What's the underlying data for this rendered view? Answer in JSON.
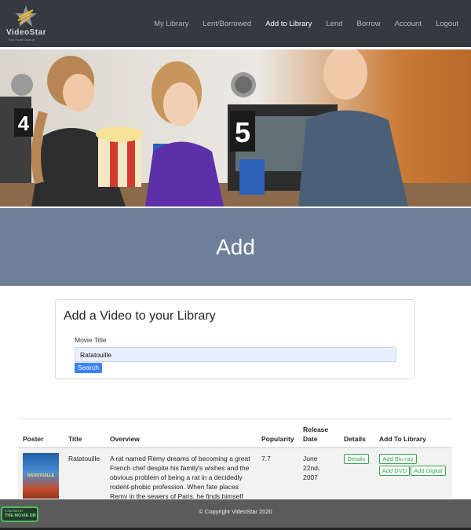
{
  "brand": {
    "name": "VideoStar",
    "tagline": "Your movie catalog"
  },
  "nav": {
    "items": [
      {
        "label": "My Library",
        "active": false
      },
      {
        "label": "Lent/Borrowed",
        "active": false
      },
      {
        "label": "Add to Library",
        "active": true
      },
      {
        "label": "Lend",
        "active": false
      },
      {
        "label": "Borrow",
        "active": false
      },
      {
        "label": "Account",
        "active": false
      },
      {
        "label": "Logout",
        "active": false
      }
    ]
  },
  "hero": {
    "signs": [
      "4",
      "5"
    ]
  },
  "page": {
    "heading": "Add"
  },
  "form": {
    "title": "Add a Video to your Library",
    "field_label": "Movie Title",
    "field_value": "Ratatouille",
    "search_label": "Search"
  },
  "table": {
    "headers": {
      "poster": "Poster",
      "title": "Title",
      "overview": "Overview",
      "popularity": "Popularity",
      "release_line1": "Release",
      "release_line2": "Date",
      "details": "Details",
      "add": "Add To Library"
    },
    "rows": [
      {
        "poster_text": "RATATOUILLE",
        "title": "Ratatouille",
        "overview_lines": [
          "A rat named Remy dreams of becoming a great",
          "French chef despite his family's wishes and the",
          "obvious problem of being a rat in a decidedly",
          "rodent-phobic profession. When fate places",
          "Remy in the sewers of Paris, he finds himself"
        ],
        "popularity": "7.7",
        "release_lines": [
          "June",
          "22nd,",
          "2007"
        ],
        "details_label": "Details",
        "add_bluray_label": "Add Blu-ray",
        "add_dvd_label": "Add DVD",
        "add_digital_label": "Add Digital"
      }
    ]
  },
  "footer": {
    "copyright": "© Copyright VideoStar 2020",
    "tmdb_small": "POWERED BY",
    "tmdb_big": "THE MOVIE DB"
  },
  "colors": {
    "navbar": "#343a40",
    "banner": "#6f7f97",
    "primary": "#3b82f6",
    "success": "#37a24b",
    "footer": "#5b5b5b"
  }
}
